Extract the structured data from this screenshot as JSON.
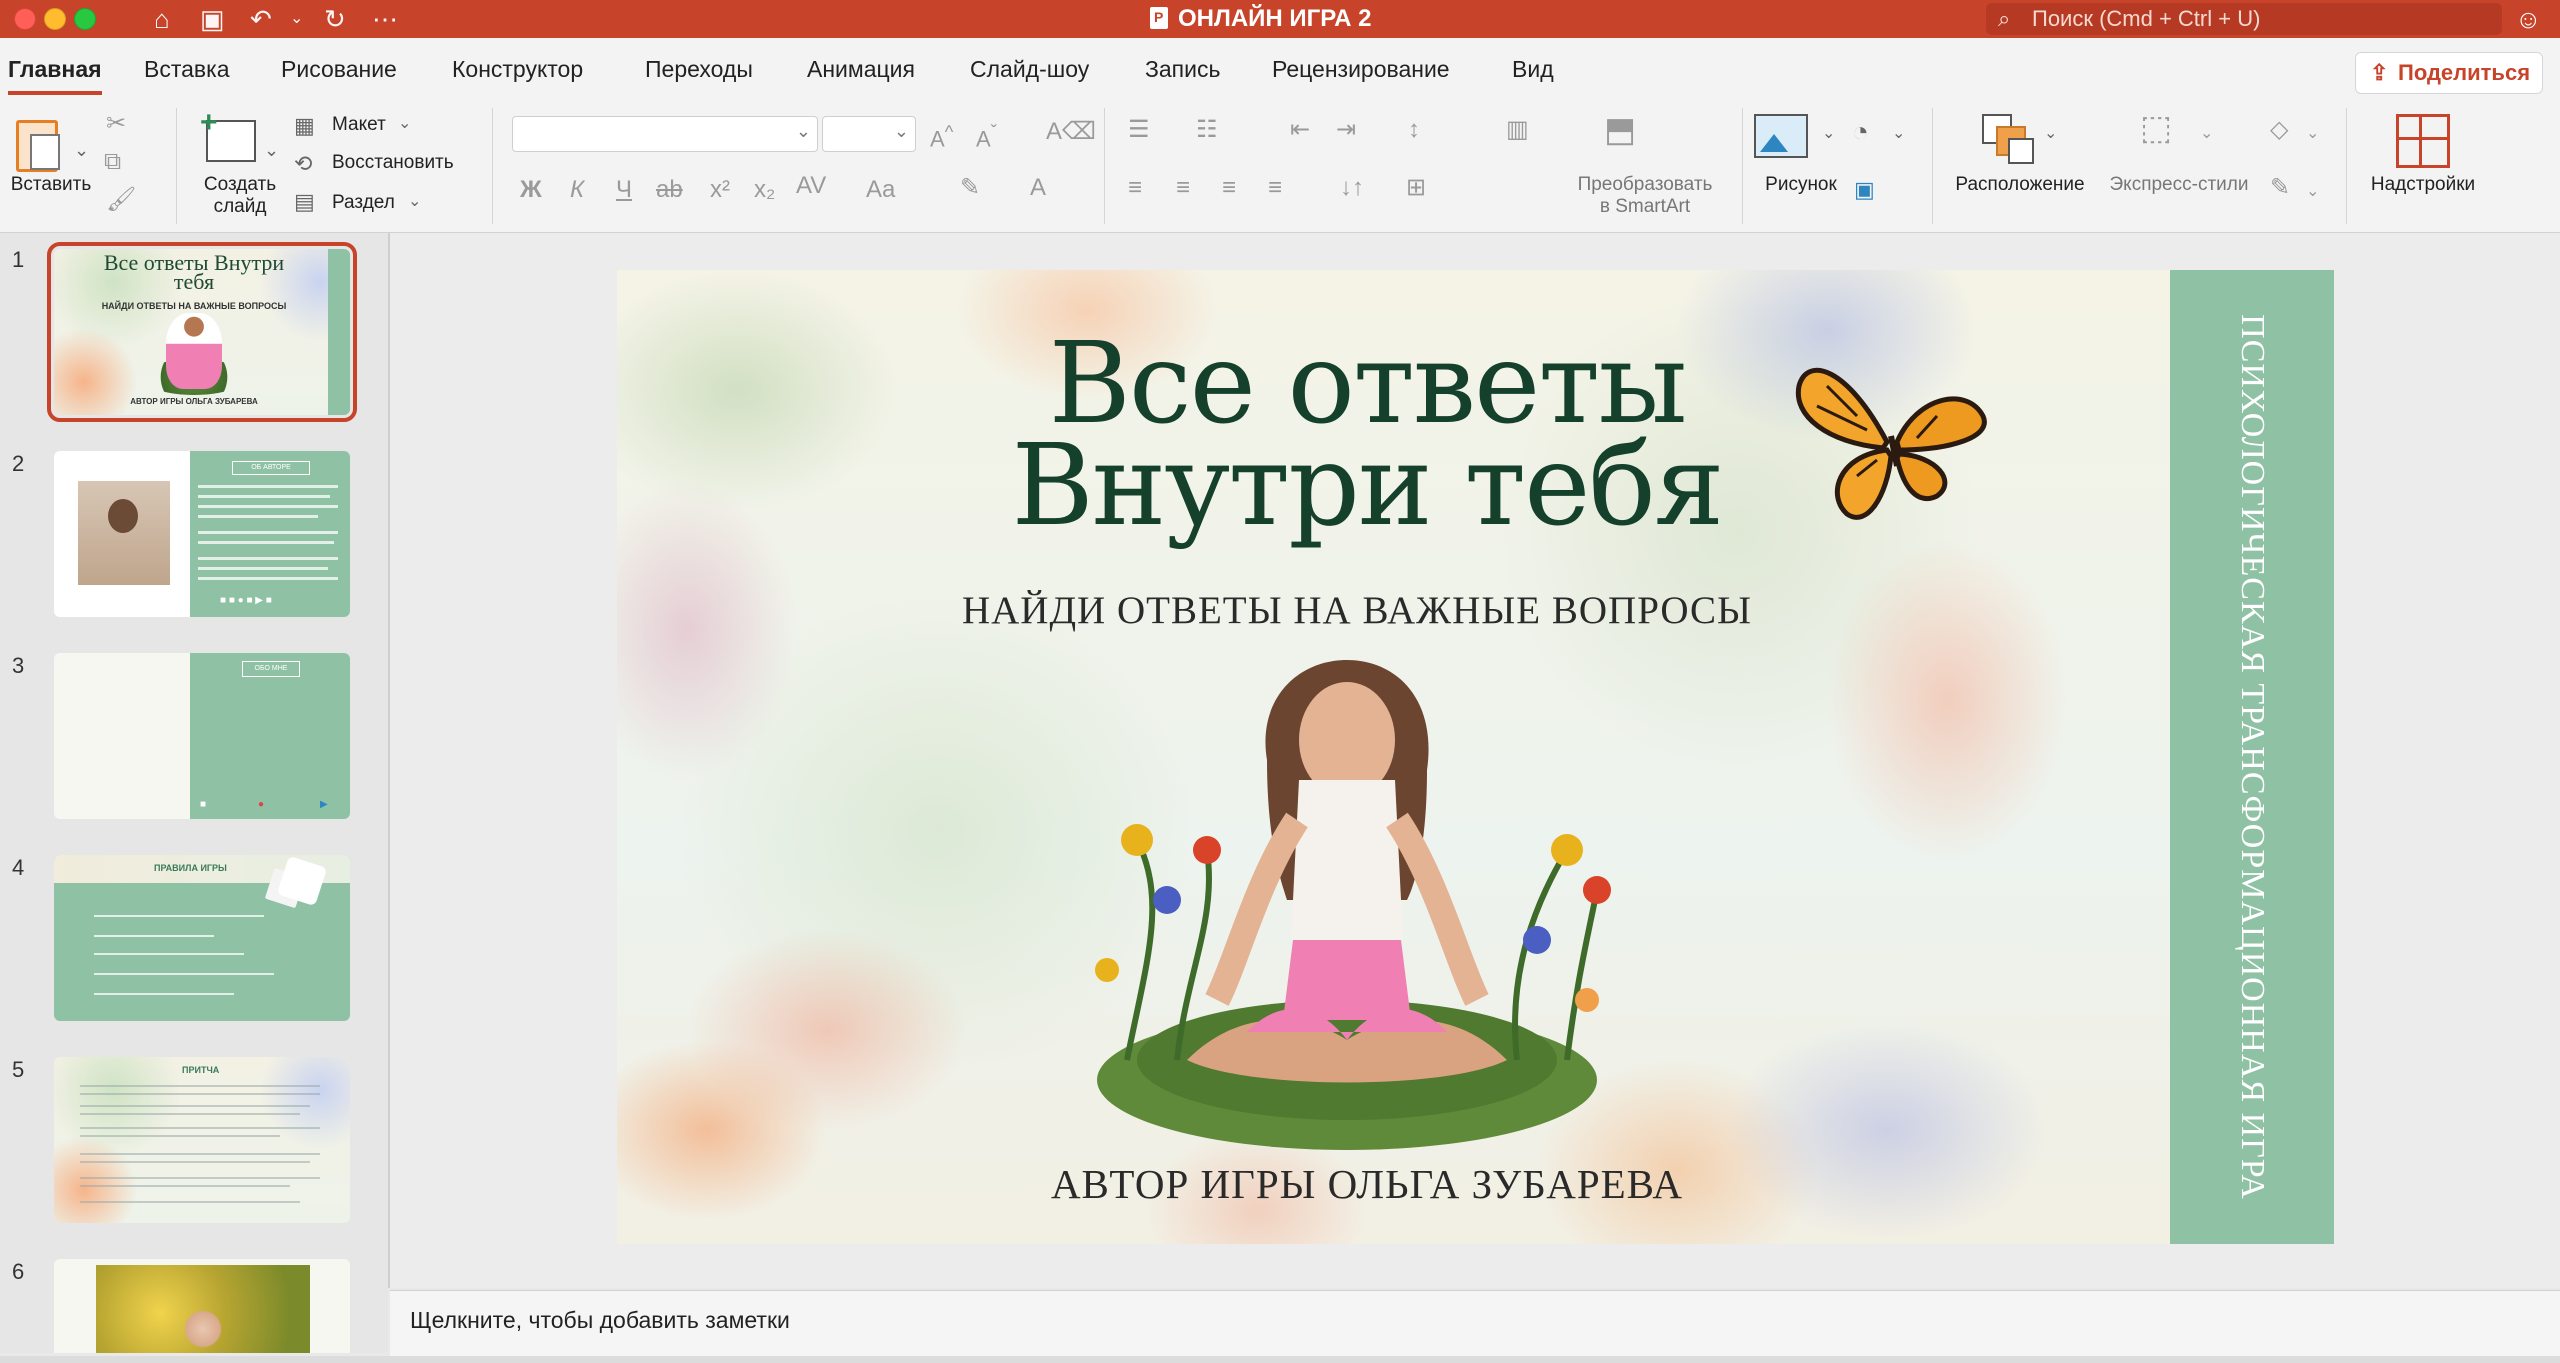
{
  "window": {
    "title": "ОНЛАЙН ИГРА  2",
    "search_placeholder": "Поиск (Cmd + Ctrl + U)"
  },
  "colors": {
    "accent": "#c7432a",
    "slide_strip": "#8fc1a5",
    "title_text": "#15402b"
  },
  "tabs": [
    "Главная",
    "Вставка",
    "Рисование",
    "Конструктор",
    "Переходы",
    "Анимация",
    "Слайд-шоу",
    "Запись",
    "Рецензирование",
    "Вид"
  ],
  "active_tab": "Главная",
  "share_label": "Поделиться",
  "ribbon": {
    "paste": "Вставить",
    "new_slide": [
      "Создать",
      "слайд"
    ],
    "layout": "Макет",
    "reset": "Восстановить",
    "section": "Раздел",
    "smartart": [
      "Преобразовать",
      "в SmartArt"
    ],
    "picture": "Рисунок",
    "arrange": "Расположение",
    "quick_styles": "Экспресс-стили",
    "addins": "Надстройки"
  },
  "thumbnails": {
    "numbers": [
      "1",
      "2",
      "3",
      "4",
      "5",
      "6"
    ],
    "t1_title": "Все ответы Внутри тебя",
    "t1_sub": "НАЙДИ ОТВЕТЫ НА ВАЖНЫЕ ВОПРОСЫ",
    "t1_author": "АВТОР ИГРЫ ОЛЬГА ЗУБАРЕВА",
    "t2_title": "ОБ АВТОРЕ",
    "t3_title": "ОБО МНЕ",
    "t4_title": "ПРАВИЛА ИГРЫ",
    "t5_title": "ПРИТЧА"
  },
  "slide": {
    "title_line1": "Все ответы",
    "title_line2": "Внутри тебя",
    "subtitle": "НАЙДИ ОТВЕТЫ НА ВАЖНЫЕ ВОПРОСЫ",
    "author": "АВТОР ИГРЫ ОЛЬГА ЗУБАРЕВА",
    "side_text": "ПСИХОЛОГИЧЕСКАЯ ТРАНСФОРМАЦИОННАЯ ИГРА"
  },
  "notes_placeholder": "Щелкните, чтобы добавить заметки"
}
